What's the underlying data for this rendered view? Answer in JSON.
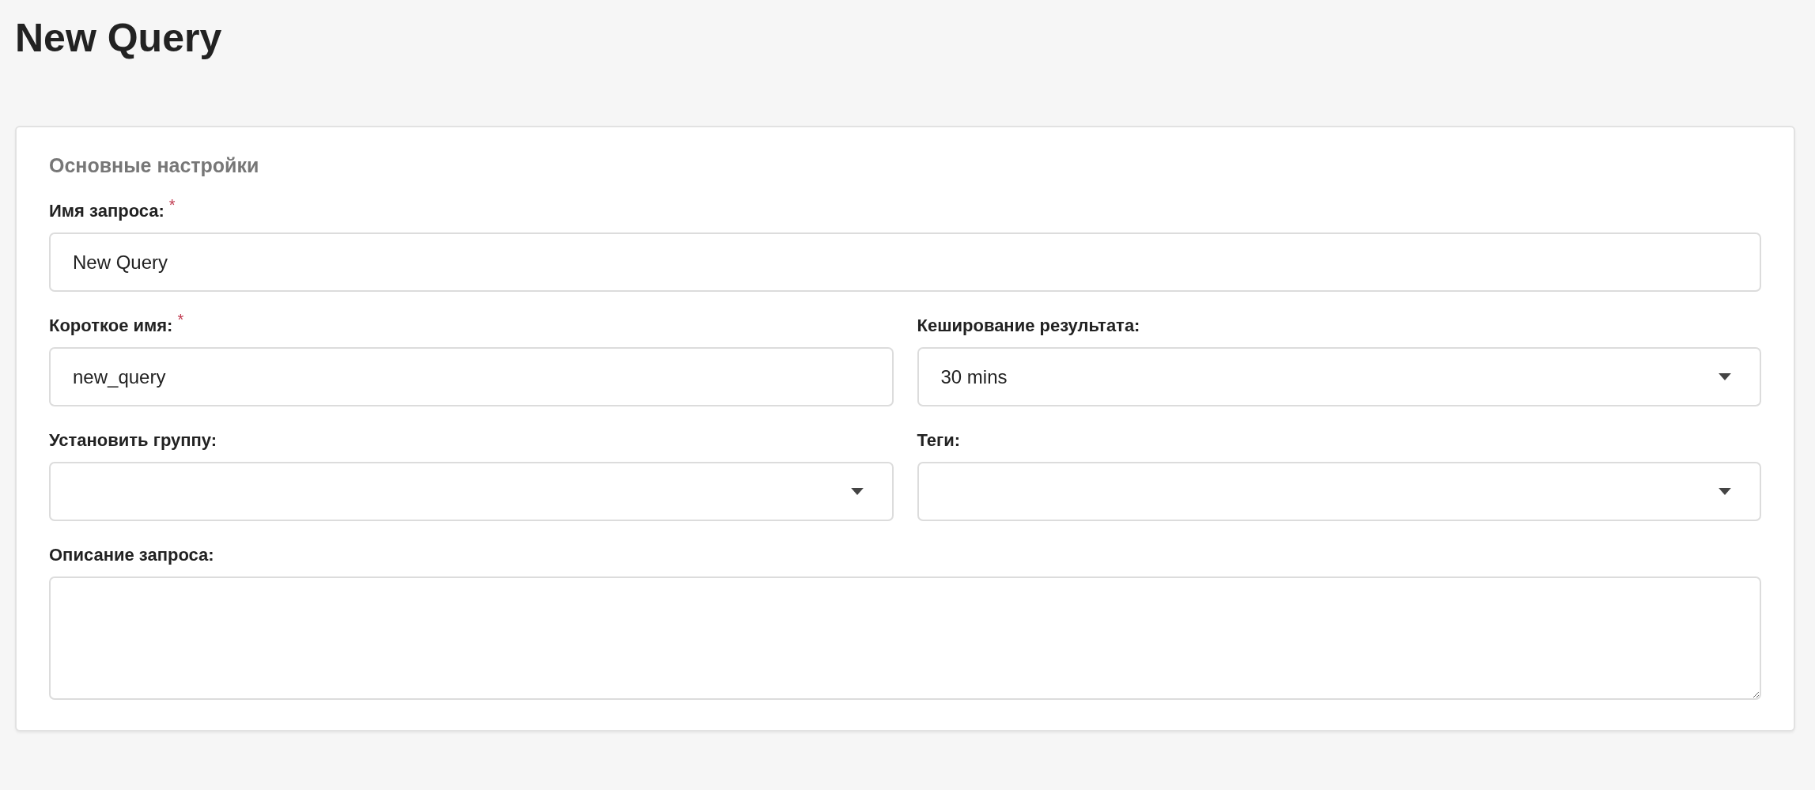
{
  "title": "New Query",
  "section": {
    "title": "Основные настройки",
    "rows": [
      [
        {
          "kind": "text",
          "label": "Имя запроса:",
          "required_mark": "*",
          "value": "New Query"
        }
      ],
      [
        {
          "kind": "text",
          "label": "Короткое имя:",
          "required_mark": "*",
          "value": "new_query"
        },
        {
          "kind": "select",
          "label": "Кеширование результата:",
          "value": "30 mins"
        }
      ],
      [
        {
          "kind": "select",
          "label": "Установить группу:"
        },
        {
          "kind": "select",
          "label": "Теги:"
        }
      ],
      [
        {
          "kind": "textarea",
          "label": "Описание запроса:"
        }
      ]
    ]
  }
}
